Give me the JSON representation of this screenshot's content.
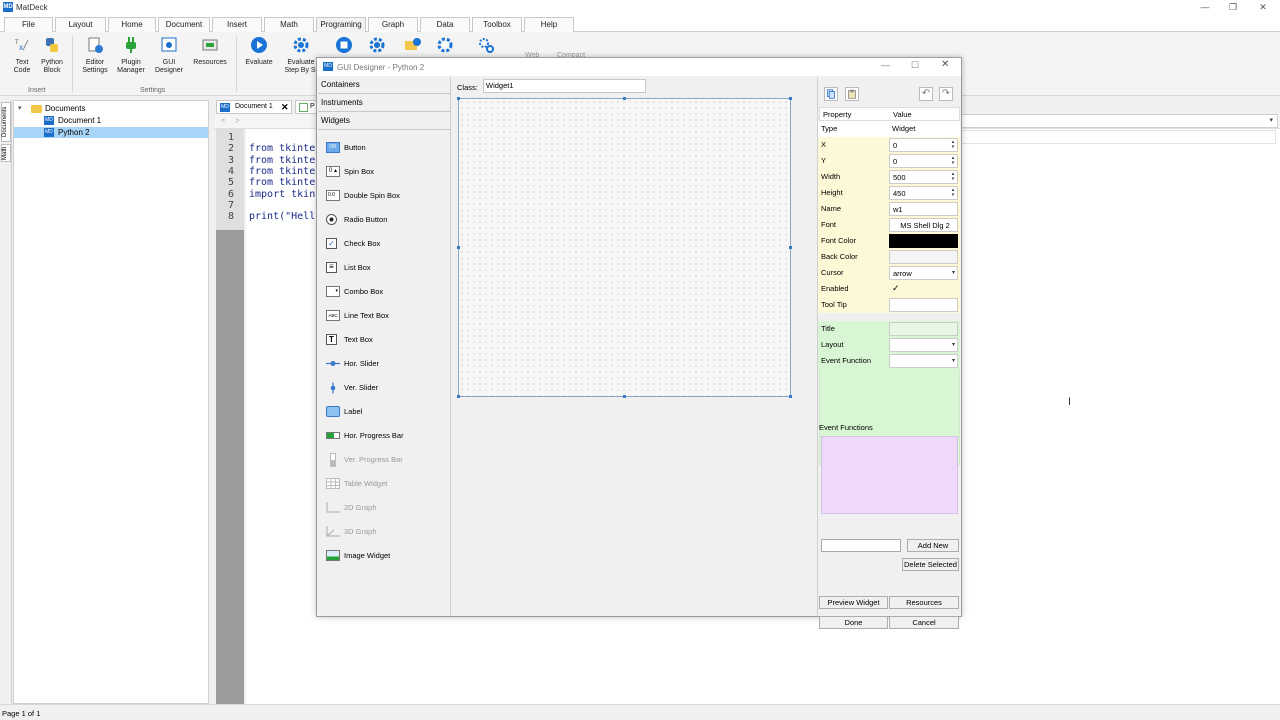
{
  "app": {
    "title": "MatDeck",
    "logo_text": "MD"
  },
  "window_controls": {
    "minimize": "—",
    "restore": "❐",
    "close": "✕"
  },
  "menu": {
    "tabs": [
      "File",
      "Layout",
      "Home",
      "Document",
      "Insert",
      "Math",
      "Programing",
      "Graph",
      "Data",
      "Toolbox",
      "Help"
    ],
    "active": "Programing"
  },
  "ribbon": {
    "buttons": [
      {
        "label_1": "Text",
        "label_2": "Code",
        "icon": "text-code-icon"
      },
      {
        "label_1": "Python",
        "label_2": "Block",
        "icon": "python-icon"
      },
      {
        "label_1": "Editor",
        "label_2": "Settings",
        "icon": "editor-settings-icon"
      },
      {
        "label_1": "Plugin",
        "label_2": "Manager",
        "icon": "plugin-icon"
      },
      {
        "label_1": "GUI",
        "label_2": "Designer",
        "icon": "gui-designer-icon"
      },
      {
        "label_1": "Resources",
        "label_2": "",
        "icon": "resources-icon"
      },
      {
        "label_1": "Evaluate",
        "label_2": "",
        "icon": "evaluate-icon"
      },
      {
        "label_1": "Evaluate",
        "label_2": "Step By St",
        "icon": "gear-icon"
      }
    ],
    "groups": {
      "insert": "Insert",
      "settings": "Settings"
    },
    "partial_labels": {
      "web": "Web",
      "compact": "Compact"
    }
  },
  "side_tabs": {
    "documents": "Documents",
    "math": "Math"
  },
  "tree": {
    "root": "Documents",
    "items": [
      {
        "label": "Document 1",
        "selected": false
      },
      {
        "label": "Python 2",
        "selected": true
      }
    ]
  },
  "doc_tabs": {
    "tab1": "Document 1",
    "tab2": "P"
  },
  "code": {
    "lines": [
      {
        "num": "1",
        "text": ""
      },
      {
        "num": "2",
        "text": "from tkinte"
      },
      {
        "num": "3",
        "text": "from tkinte"
      },
      {
        "num": "4",
        "text": "from tkinte"
      },
      {
        "num": "5",
        "text": "from tkinte"
      },
      {
        "num": "6",
        "text": "import tkin"
      },
      {
        "num": "7",
        "text": ""
      },
      {
        "num": "8",
        "text": "print(\"Hell"
      }
    ]
  },
  "status": {
    "page": "Page 1 of 1"
  },
  "dialog": {
    "title": "GUI Designer - Python 2",
    "class_label": "Class:",
    "class_value": "Widget1",
    "palette": {
      "sections": [
        "Containers",
        "Instruments",
        "Widgets"
      ],
      "widgets": [
        {
          "label": "Button",
          "icon": "button-icon",
          "enabled": true,
          "glyph": "OK"
        },
        {
          "label": "Spin Box",
          "icon": "spin-box-icon",
          "enabled": true,
          "glyph": "0"
        },
        {
          "label": "Double Spin Box",
          "icon": "double-spin-box-icon",
          "enabled": true,
          "glyph": "0.0"
        },
        {
          "label": "Radio Button",
          "icon": "radio-button-icon",
          "enabled": true,
          "glyph": "●"
        },
        {
          "label": "Check Box",
          "icon": "check-box-icon",
          "enabled": true,
          "glyph": "✓"
        },
        {
          "label": "List Box",
          "icon": "list-box-icon",
          "enabled": true,
          "glyph": "≡"
        },
        {
          "label": "Combo Box",
          "icon": "combo-box-icon",
          "enabled": true,
          "glyph": "▾"
        },
        {
          "label": "Line Text Box",
          "icon": "line-text-box-icon",
          "enabled": true,
          "glyph": "ABC"
        },
        {
          "label": "Text Box",
          "icon": "text-box-icon",
          "enabled": true,
          "glyph": "T"
        },
        {
          "label": "Hor. Slider",
          "icon": "horizontal-slider-icon",
          "enabled": true,
          "glyph": ""
        },
        {
          "label": "Ver. Slider",
          "icon": "vertical-slider-icon",
          "enabled": true,
          "glyph": ""
        },
        {
          "label": "Label",
          "icon": "label-icon",
          "enabled": true,
          "glyph": ""
        },
        {
          "label": "Hor. Progress Bar",
          "icon": "horizontal-progress-bar-icon",
          "enabled": true,
          "glyph": ""
        },
        {
          "label": "Ver. Progress Bar",
          "icon": "vertical-progress-bar-icon",
          "enabled": false,
          "glyph": ""
        },
        {
          "label": "Table Widget",
          "icon": "table-widget-icon",
          "enabled": false,
          "glyph": ""
        },
        {
          "label": "2D Graph",
          "icon": "2d-graph-icon",
          "enabled": false,
          "glyph": ""
        },
        {
          "label": "3D Graph",
          "icon": "3d-graph-icon",
          "enabled": false,
          "glyph": ""
        },
        {
          "label": "Image Widget",
          "icon": "image-widget-icon",
          "enabled": true,
          "glyph": ""
        }
      ]
    },
    "properties": {
      "header": {
        "name": "Property",
        "value": "Value"
      },
      "rows": [
        {
          "name": "Type",
          "value": "Widget",
          "kind": "plain",
          "bg": "#ffffff"
        },
        {
          "name": "X",
          "value": "0",
          "kind": "spin",
          "bg": "#fdf9d6"
        },
        {
          "name": "Y",
          "value": "0",
          "kind": "spin",
          "bg": "#fdf9d6"
        },
        {
          "name": "Width",
          "value": "500",
          "kind": "spin",
          "bg": "#fdf9d6"
        },
        {
          "name": "Height",
          "value": "450",
          "kind": "spin",
          "bg": "#fdf9d6"
        },
        {
          "name": "Name",
          "value": "w1",
          "kind": "text",
          "bg": "#fdf9d6"
        },
        {
          "name": "Font",
          "value": "MS Shell Dlg 2",
          "kind": "center",
          "bg": "#fdf9d6"
        },
        {
          "name": "Font Color",
          "value": "",
          "kind": "color-black",
          "bg": "#fdf9d6"
        },
        {
          "name": "Back Color",
          "value": "",
          "kind": "color-white",
          "bg": "#fdf9d6"
        },
        {
          "name": "Cursor",
          "value": "arrow",
          "kind": "dropdown",
          "bg": "#fdf9d6"
        },
        {
          "name": "Enabled",
          "value": "✓",
          "kind": "check",
          "bg": "#fdf9d6"
        },
        {
          "name": "Tool Tip",
          "value": "",
          "kind": "text",
          "bg": "#fdf9d6"
        }
      ],
      "layout_rows": [
        {
          "name": "Title",
          "value": "",
          "kind": "text"
        },
        {
          "name": "Layout",
          "value": "",
          "kind": "dropdown"
        },
        {
          "name": "Event Function",
          "value": "",
          "kind": "dropdown"
        }
      ],
      "colors": {
        "yellow": "#fdf9d6",
        "green": "#d8f6d3",
        "lilac": "#efd9fb"
      }
    },
    "event_functions": {
      "label": "Event Functions",
      "add_new": "Add New",
      "delete_selected": "Delete Selected"
    },
    "buttons": {
      "preview": "Preview Widget",
      "resources": "Resources",
      "done": "Done",
      "cancel": "Cancel"
    }
  }
}
